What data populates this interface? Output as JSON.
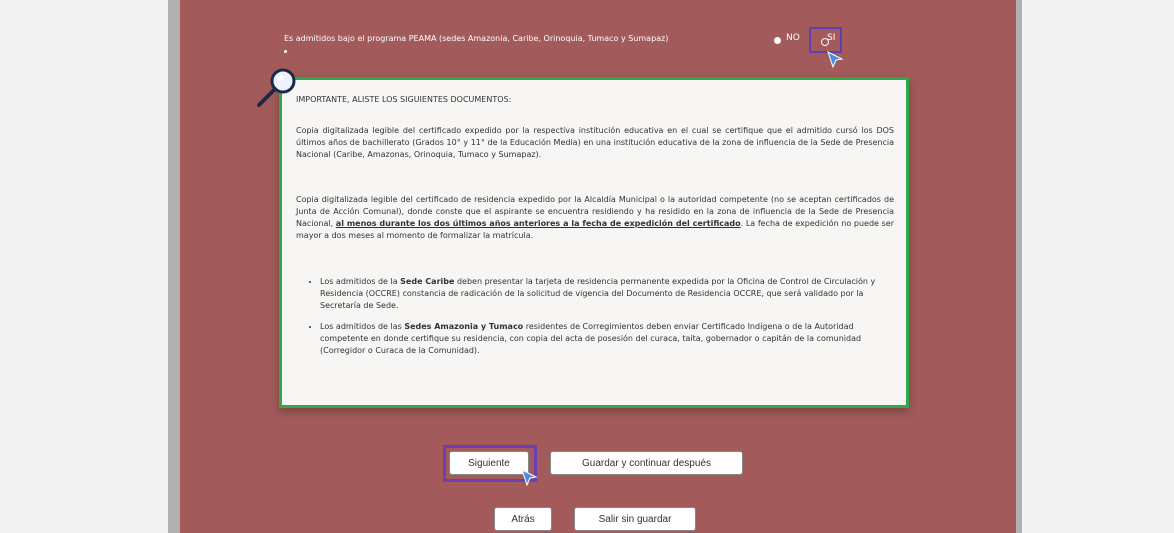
{
  "question": {
    "text": "Es admitidos bajo el programa PEAMA (sedes Amazonia, Caribe, Orinoquia, Tumaco y Sumapaz)",
    "option_no": "NO",
    "option_si": "SI",
    "selected": "SI"
  },
  "notice": {
    "heading": "IMPORTANTE, ALISTE LOS SIGUIENTES DOCUMENTOS:",
    "paragraph1": "Copia digitalizada legible del certificado expedido por la respectiva institución educativa en el cual se certifique que el admitido cursó los DOS últimos años de bachillerato (Grados 10° y 11° de la Educación Media) en una institución educativa de la zona de influencia de la Sede de Presencia Nacional (Caribe, Amazonas, Orinoquia, Tumaco y Sumapaz).",
    "paragraph2_start": "Copia digitalizada legible del certificado de residencia expedido por la Alcaldía Municipal o la autoridad competente (no se aceptan certificados de Junta de Acción Comunal), donde conste que el aspirante se encuentra residiendo y ha residido en la zona de influencia de la Sede de Presencia Nacional,",
    "paragraph2_emphasis": "al menos durante los dos últimos años anteriores a la fecha de expedición del certificado",
    "paragraph2_end": ". La fecha de expedición no puede ser mayor a dos meses al momento de formalizar la matrícula.",
    "bullet1_a": "Los admitidos de la ",
    "bullet1_bold": "Sede Caribe",
    "bullet1_b": " deben presentar la tarjeta de residencia permanente expedida por la Oficina de Control de Circulación y Residencia (OCCRE) constancia de radicación de la solicitud de vigencia del Documento de Residencia OCCRE, que será validado por la Secretaría de Sede.",
    "bullet2_a": "Los admitidos de las ",
    "bullet2_bold": "Sedes Amazonia y Tumaco",
    "bullet2_b": " residentes de Corregimientos deben enviar Certificado Indígena o de la Autoridad competente en donde certifique su residencia, con copia del acta de posesión del curaca, taita, gobernador o capitán de la comunidad (Corregidor o Curaca de la Comunidad)."
  },
  "buttons": {
    "next": "Siguiente",
    "save_continue": "Guardar y continuar después",
    "back": "Atrás",
    "exit": "Salir sin guardar"
  },
  "colors": {
    "panel": "#a25a5a",
    "notice_border": "#2fa84a",
    "focus": "#6b3fb5"
  },
  "icons": [
    "magnifier-icon",
    "cursor-icon"
  ]
}
